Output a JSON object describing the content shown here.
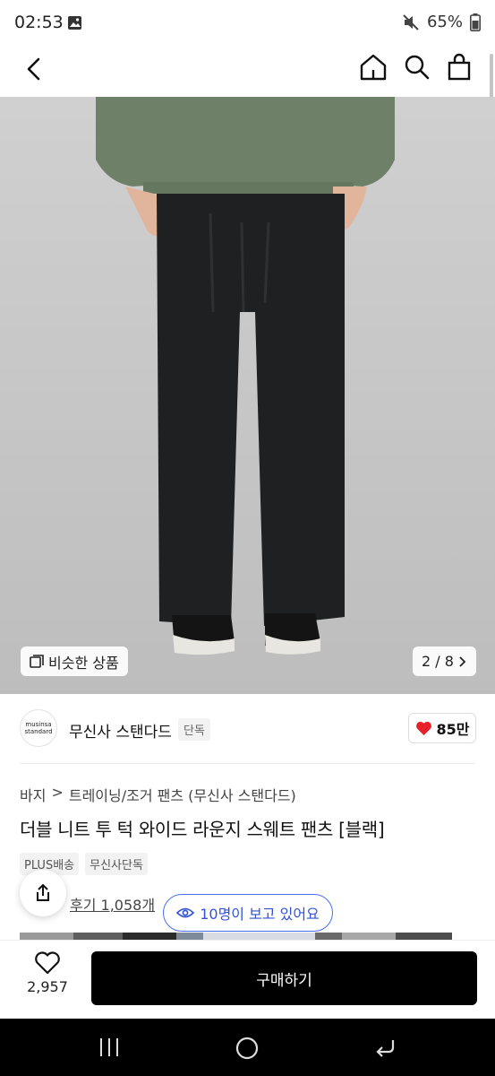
{
  "status_bar": {
    "time": "02:53",
    "battery": "65%"
  },
  "hero": {
    "similar_label": "비슷한 상품",
    "page_indicator": "2 / 8"
  },
  "brand": {
    "logo_line1": "musinsa",
    "logo_line2": "standard",
    "name": "무신사 스탠다드",
    "tag": "단독",
    "likes": "85만"
  },
  "breadcrumb": {
    "parent": "바지",
    "separator": ">",
    "category": "트레이닝/조거 팬츠 (무신사 스탠다드)"
  },
  "product": {
    "title": "더블 니트 투 턱 와이드 라운지 스웨트 팬츠 [블랙]"
  },
  "badges": [
    "PLUS배송",
    "무신사단독"
  ],
  "review": {
    "label": "후기 1,058개"
  },
  "viewers": {
    "text": "10명이 보고 있어요"
  },
  "bottom": {
    "wish_count": "2,957",
    "buy_label": "구매하기"
  },
  "colors": {
    "accent_blue": "#3352d6",
    "heart_red": "#e8202a",
    "buy_bg": "#000000"
  },
  "icons": [
    "back-icon",
    "home-icon",
    "search-icon",
    "cart-icon",
    "similar-icon",
    "chevron-right-icon",
    "heart-icon",
    "share-icon",
    "eye-icon",
    "nav-recents-icon",
    "nav-home-icon",
    "nav-back-icon"
  ]
}
